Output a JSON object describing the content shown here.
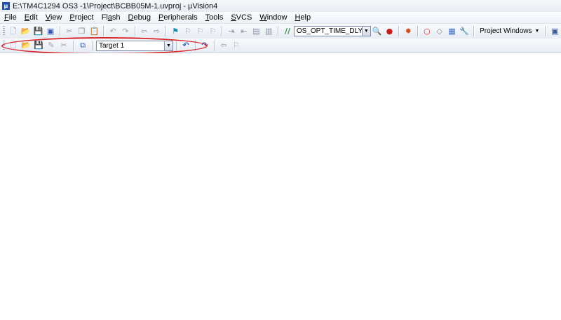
{
  "window": {
    "title": "E:\\TM4C1294 OS3 -1\\Project\\BCBB05M-1.uvproj - µVision4",
    "app_icon": "uvision-icon"
  },
  "menu": [
    {
      "label": "File",
      "key": "F",
      "rest": "ile"
    },
    {
      "label": "Edit",
      "key": "E",
      "rest": "dit"
    },
    {
      "label": "View",
      "key": "V",
      "rest": "iew"
    },
    {
      "label": "Project",
      "key": "P",
      "rest": "roject"
    },
    {
      "label": "Flash",
      "key": "a",
      "pre": "Fl",
      "rest": "sh"
    },
    {
      "label": "Debug",
      "key": "D",
      "rest": "ebug"
    },
    {
      "label": "Peripherals",
      "key": "P",
      "rest": "eripherals"
    },
    {
      "label": "Tools",
      "key": "T",
      "rest": "ools"
    },
    {
      "label": "SVCS",
      "key": "S",
      "rest": "VCS"
    },
    {
      "label": "Window",
      "key": "W",
      "rest": "indow"
    },
    {
      "label": "Help",
      "key": "H",
      "rest": "elp"
    }
  ],
  "toolbar1": {
    "find_combo_value": "OS_OPT_TIME_DLY",
    "project_windows_label": "Project Windows"
  },
  "toolbar2": {
    "target_combo_value": "Target 1"
  },
  "annotation": {
    "color": "#d8262b"
  }
}
